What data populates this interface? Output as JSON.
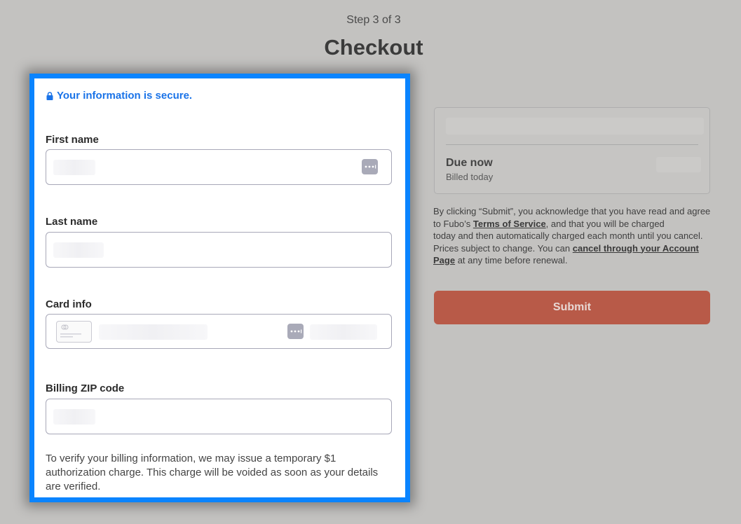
{
  "header": {
    "step": "Step 3 of 3",
    "title": "Checkout"
  },
  "form": {
    "secure_notice": "Your information is secure.",
    "first_name_label": "First name",
    "last_name_label": "Last name",
    "card_info_label": "Card info",
    "zip_label": "Billing ZIP code",
    "verification_note": "To verify your billing information, we may issue a temporary $1 authorization charge. This charge will be voided as soon as your details are verified."
  },
  "summary": {
    "due_now": "Due now",
    "billed_today": "Billed today"
  },
  "legal": {
    "part1": "By clicking “Submit”, you acknowledge that you have read and agree to Fubo’s ",
    "terms_link": "Terms of Service",
    "part2": ", and that you will be charged ",
    "part3": " today and then automatically charged each month until you cancel. Prices subject to change. You can ",
    "cancel_link": "cancel through your Account Page",
    "part4": " at any time before renewal."
  },
  "actions": {
    "submit_label": "Submit"
  },
  "colors": {
    "accent_border": "#0a84ff",
    "secure_text": "#1a73e8",
    "submit_bg": "#b85a48",
    "page_bg": "#c3c2c0"
  },
  "icons": [
    "lock-icon",
    "dots-icon",
    "credit-card-icon"
  ]
}
